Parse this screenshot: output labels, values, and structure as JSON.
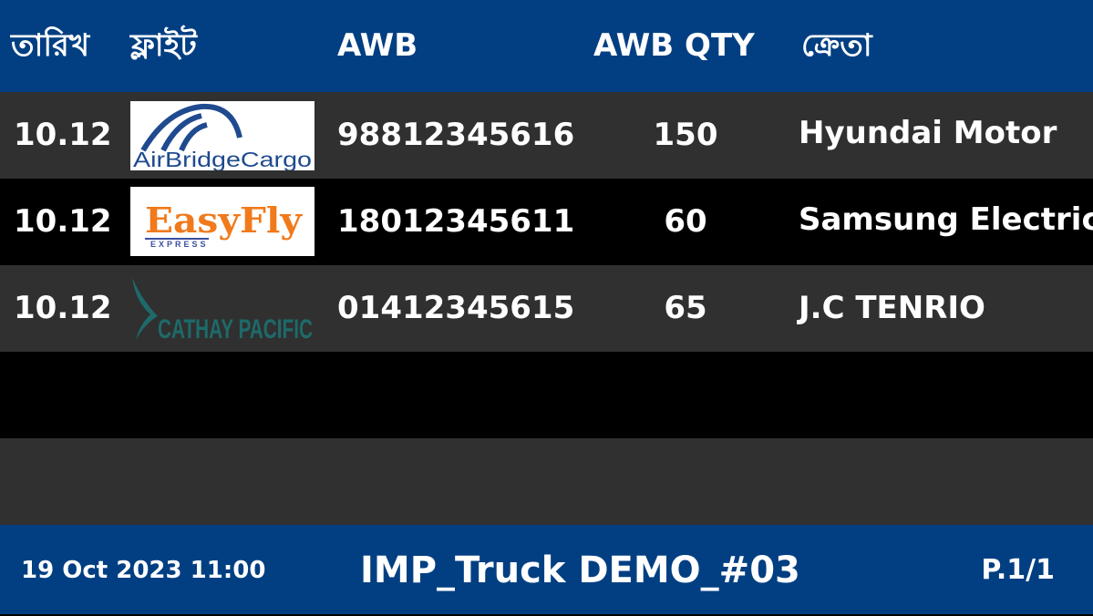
{
  "header": {
    "date": "তারিখ",
    "flight": "ফ্লাইট",
    "awb": "AWB",
    "awb_qty": "AWB QTY",
    "buyer": "ক্রেতা"
  },
  "rows": [
    {
      "date": "10.12",
      "airline_logo": "AirBridgeCargo",
      "awb": "98812345616",
      "qty": "150",
      "buyer": "Hyundai Motor"
    },
    {
      "date": "10.12",
      "airline_logo": "EasyFly",
      "logo_sub": "EXPRESS",
      "awb": "18012345611",
      "qty": "60",
      "buyer": "Samsung Electric"
    },
    {
      "date": "10.12",
      "airline_logo": "CATHAY PACIFIC",
      "awb": "01412345615",
      "qty": "65",
      "buyer": "J.C TENRIO"
    }
  ],
  "footer": {
    "datetime": "19 Oct 2023 11:00",
    "title": "IMP_Truck DEMO_#03",
    "page": "P.1/1"
  },
  "colors": {
    "header_bg": "#013f82",
    "row_grey": "#303030",
    "row_black": "#000000",
    "text": "#ffffff",
    "abc_blue": "#1f4a8f",
    "easyfly_orange": "#f07a1c",
    "cathay_teal": "#1e6a6a"
  }
}
